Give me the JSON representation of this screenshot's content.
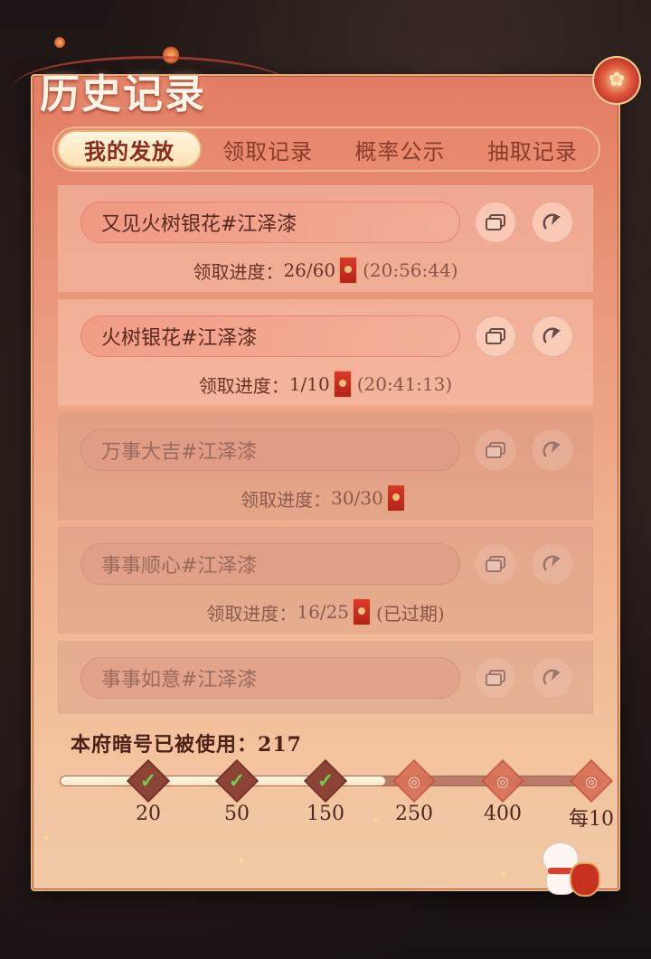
{
  "header": {
    "title": "历史记录"
  },
  "tabs": [
    {
      "label": "我的发放",
      "active": true
    },
    {
      "label": "领取记录",
      "active": false
    },
    {
      "label": "概率公示",
      "active": false
    },
    {
      "label": "抽取记录",
      "active": false
    }
  ],
  "records": [
    {
      "name": "又见火树银花#江泽漆",
      "progress_label": "领取进度：",
      "progress": "26/60",
      "time": "(20:56:44)",
      "active": true
    },
    {
      "name": "火树银花#江泽漆",
      "progress_label": "领取进度：",
      "progress": "1/10",
      "time": "(20:41:13)",
      "active": true
    },
    {
      "name": "万事大吉#江泽漆",
      "progress_label": "领取进度：",
      "progress": "30/30",
      "time": "",
      "active": false
    },
    {
      "name": "事事顺心#江泽漆",
      "progress_label": "领取进度：",
      "progress": "16/25",
      "time": "(已过期)",
      "active": false
    },
    {
      "name": "事事如意#江泽漆",
      "progress_label": "",
      "progress": "",
      "time": "",
      "active": false
    }
  ],
  "usage": {
    "label": "本府暗号已被使用：",
    "count": "217",
    "progress_fraction": 0.6
  },
  "milestones": [
    {
      "label": "20",
      "reached": true
    },
    {
      "label": "50",
      "reached": true
    },
    {
      "label": "150",
      "reached": true
    },
    {
      "label": "250",
      "reached": false
    },
    {
      "label": "400",
      "reached": false
    },
    {
      "label": "每10",
      "reached": false
    }
  ],
  "icons": {
    "copy": "copy-icon",
    "share": "share-icon",
    "red_envelope": "red-envelope-icon",
    "check": "check-icon"
  },
  "colors": {
    "accent": "#c8301f",
    "panel_top": "#e27c63",
    "panel_bottom": "#f0c9a5",
    "check": "#6fd04a"
  }
}
